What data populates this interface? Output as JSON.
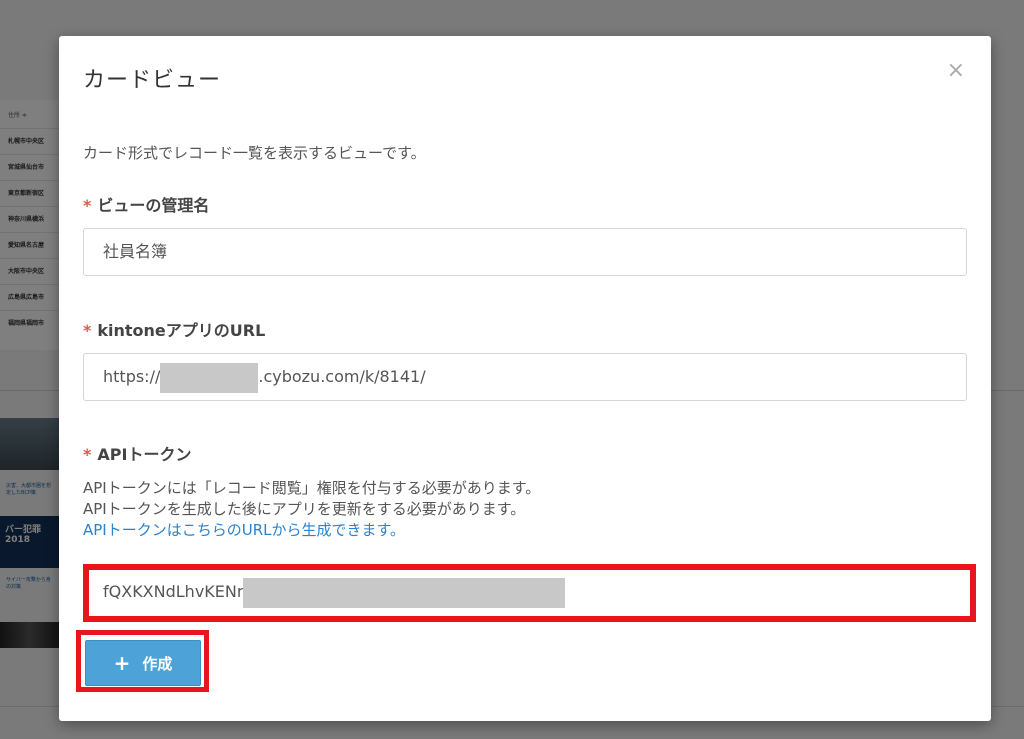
{
  "background": {
    "table_header": "住所 ≑",
    "table_rows": [
      "札幌市中央区",
      "宮城県仙台市",
      "東京都新宿区",
      "神奈川県横浜",
      "愛知県名古屋",
      "大阪市中央区",
      "広島県広島市",
      "福岡県福岡市"
    ],
    "news1": "災害、大都市圏を想定したBCP策",
    "thumb2_text": "バー犯罪 2018",
    "news2": "サイバー攻撃から身の対策"
  },
  "modal": {
    "title": "カードビュー",
    "close_icon": "×",
    "description": "カード形式でレコード一覧を表示するビューです。",
    "view_name": {
      "required_mark": "*",
      "label": "ビューの管理名",
      "value": "社員名簿"
    },
    "app_url": {
      "required_mark": "*",
      "label": "kintoneアプリのURL",
      "value_prefix": "https://",
      "value_suffix": ".cybozu.com/k/8141/"
    },
    "api_token": {
      "required_mark": "*",
      "label": "APIトークン",
      "help_line1": "APIトークンには「レコード閲覧」権限を付与する必要があります。",
      "help_line2": "APIトークンを生成した後にアプリを更新をする必要があります。",
      "help_link": "APIトークンはこちらのURLから生成できます。",
      "value_visible": "fQXKXNdLhvKENr"
    },
    "create_button": {
      "icon": "+",
      "label": "作成"
    }
  },
  "colors": {
    "accent_button": "#4da3d8",
    "link": "#2b82cc",
    "required": "#e05a4a",
    "highlight": "#e8141e"
  }
}
